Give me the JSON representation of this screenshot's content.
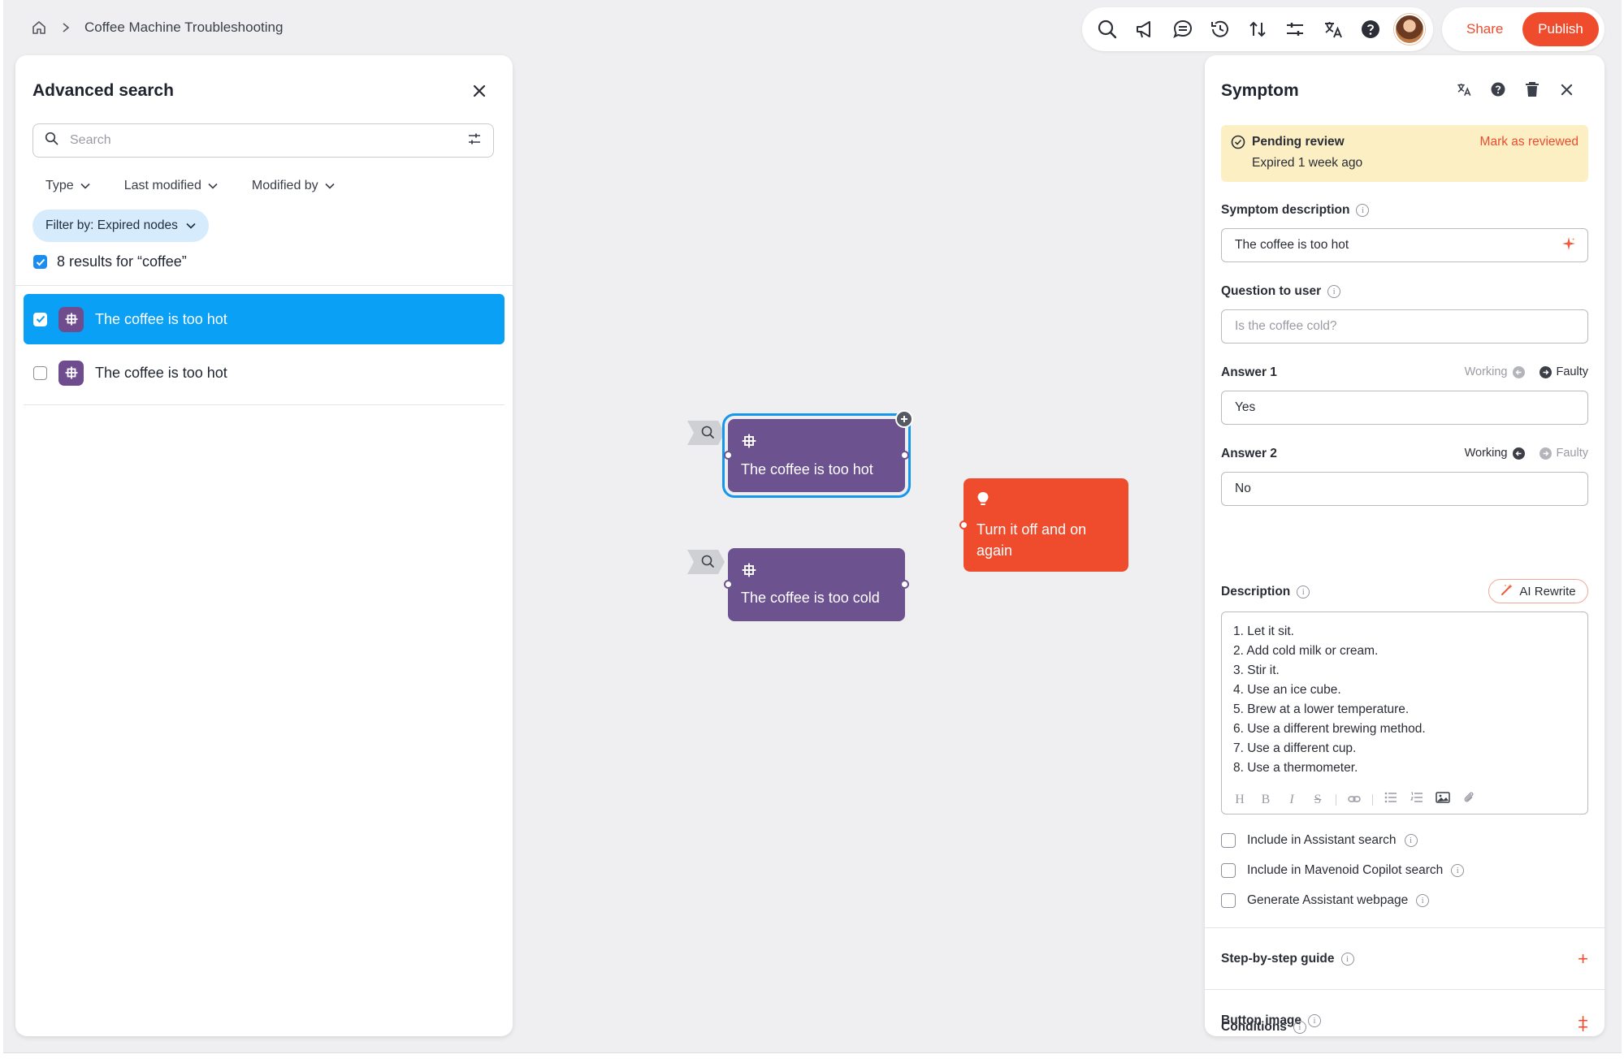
{
  "breadcrumb": {
    "current": "Coffee Machine Troubleshooting"
  },
  "toolbar": {
    "icons": [
      "search-icon",
      "megaphone-icon",
      "comments-icon",
      "history-icon",
      "sort-icon",
      "sliders-icon",
      "translate-icon",
      "help-icon"
    ],
    "share_label": "Share",
    "publish_label": "Publish",
    "accent": "#ef4b2d"
  },
  "advanced_search": {
    "title": "Advanced search",
    "search_placeholder": "Search",
    "filters": [
      "Type",
      "Last modified",
      "Modified by"
    ],
    "chip": "Filter by: Expired nodes",
    "results_label": "8 results for “coffee”",
    "results": [
      {
        "label": "The coffee is too hot",
        "checked": true,
        "selected": true
      },
      {
        "label": "The coffee is too hot",
        "checked": false,
        "selected": false
      }
    ]
  },
  "canvas": {
    "nodes": [
      {
        "label": "The coffee is too hot",
        "type": "symptom",
        "selected": true
      },
      {
        "label": "The coffee is too cold",
        "type": "symptom",
        "selected": false
      }
    ],
    "solution": {
      "label_line1": "Turn it off and on",
      "label_line2": "again"
    },
    "colors": {
      "symptom": "#6d5290",
      "solution": "#ef4b2d",
      "selection": "#1796ee"
    }
  },
  "symptom_panel": {
    "title": "Symptom",
    "pending": {
      "title": "Pending review",
      "subtitle": "Expired 1 week ago",
      "action": "Mark as reviewed"
    },
    "symptom_description_label": "Symptom description",
    "symptom_description_value": "The coffee is too hot",
    "question_label": "Question to user",
    "question_placeholder": "Is the coffee cold?",
    "answer1": {
      "label": "Answer 1",
      "value": "Yes",
      "working": "Working",
      "faulty": "Faulty",
      "selected": "faulty"
    },
    "answer2": {
      "label": "Answer 2",
      "value": "No",
      "working": "Working",
      "faulty": "Faulty",
      "selected": "working"
    },
    "description_label": "Description",
    "ai_rewrite": "AI Rewrite",
    "description_lines": [
      "1. Let it sit.",
      "2. Add cold milk or cream.",
      "3. Stir it.",
      "4. Use an ice cube.",
      "5. Brew at a lower temperature.",
      "6. Use a different brewing method.",
      "7. Use a different cup.",
      "8. Use a thermometer."
    ],
    "checkboxes": [
      "Include in Assistant search",
      "Include in Mavenoid Copilot search",
      "Generate Assistant webpage"
    ],
    "sections": [
      "Step-by-step guide",
      "Button image",
      "Conditions"
    ]
  }
}
